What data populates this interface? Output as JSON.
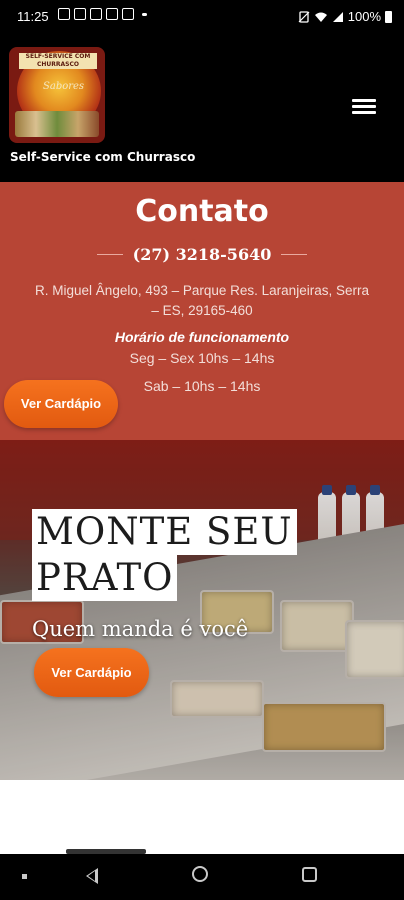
{
  "status_bar": {
    "time": "11:25",
    "battery": "100%",
    "icons": [
      "notification-icon",
      "facebook-icon",
      "facebook-icon",
      "gallery-icon",
      "instagram-icon",
      "more-dot-icon",
      "no-sim-icon",
      "wifi-icon",
      "signal-icon",
      "battery-icon"
    ]
  },
  "header": {
    "logo_band_text": "SELF-SERVICE COM CHURRASCO",
    "logo_script_text": "Sabores",
    "brand_text": "Self-Service com Churrasco",
    "menu_icon": "hamburger-menu-icon"
  },
  "contact": {
    "title": "Contato",
    "phone": "(27) 3218-5640",
    "address": "R. Miguel Ângelo, 493 – Parque Res. Laranjeiras, Serra – ES, 29165-460",
    "hours_title": "Horário de funcionamento",
    "hours_weekdays": "Seg – Sex  10hs – 14hs",
    "hours_saturday": "Sab –  10hs – 14hs",
    "background_color": "#b74535"
  },
  "buttons": {
    "menu_label": "Ver Cardápio",
    "accent_color": "#f26a1b"
  },
  "hero": {
    "title_line1": "MONTE SEU",
    "title_line2": "PRATO",
    "subtitle": "Quem manda é você",
    "cta_label": "Ver Cardápio"
  },
  "nav_bar": {
    "icons": [
      "square-icon",
      "back-icon",
      "home-icon",
      "recent-apps-icon"
    ]
  }
}
